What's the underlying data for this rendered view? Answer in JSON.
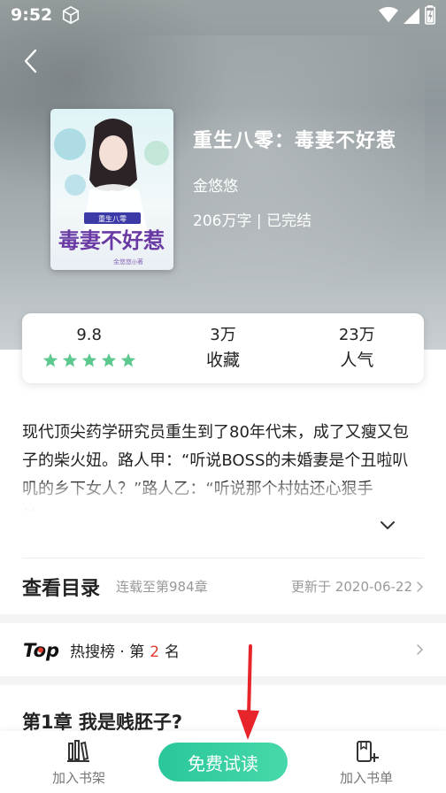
{
  "status_bar": {
    "time": "9:52"
  },
  "book": {
    "title": "重生八零：毒妻不好惹",
    "author": "金悠悠",
    "meta": "206万字 | 已完结",
    "cover_title": "毒妻不好惹",
    "cover_subtitle": "重生八零",
    "cover_author": "金悠悠◎著"
  },
  "stats": {
    "rating": "9.8",
    "stars": 5,
    "favorites_num": "3万",
    "favorites_label": "收藏",
    "popularity_num": "23万",
    "popularity_label": "人气"
  },
  "synopsis": "现代顶尖药学研究员重生到了80年代末，成了又瘦又包子的柴火妞。路人甲：“听说BOSS的未婚妻是个丑啦叭叽的乡下女人？”路人乙：“听说那个村姑还心狠手辣……”",
  "toc": {
    "title": "查看目录",
    "serial": "连载至第984章",
    "updated": "更新于 2020-06-22"
  },
  "rank": {
    "logo": "Top",
    "prefix": "热搜榜 · 第",
    "number": "2",
    "suffix": "名"
  },
  "chapter": {
    "title": "第1章 我是贱胚子?"
  },
  "bottom": {
    "add_shelf": "加入书架",
    "read_free": "免费试读",
    "add_list": "加入书单"
  },
  "colors": {
    "accent": "#2ecc9c",
    "star": "#5cc98e",
    "rank_red": "#e33a2f"
  }
}
